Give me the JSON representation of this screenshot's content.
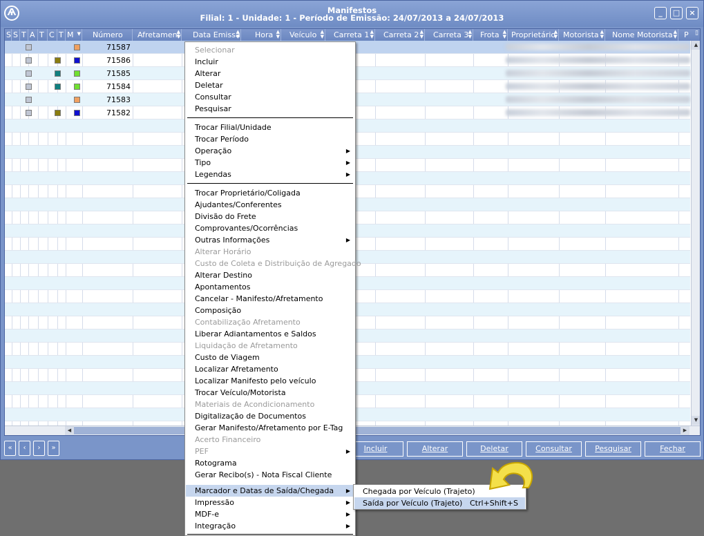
{
  "window": {
    "title": "Manifestos",
    "subtitle": "Filial: 1 - Unidade: 1 - Período de Emissão: 24/07/2013 a 24/07/2013",
    "logo_icon": "compass-logo-icon",
    "controls": {
      "minimize": "_",
      "maximize": "□",
      "close": "×"
    }
  },
  "grid": {
    "columns": [
      "S",
      "S",
      "T",
      "A",
      "T",
      "C",
      "T",
      "M",
      "Número",
      "Afretamento",
      "Data Emissão",
      "Hora",
      "Veículo",
      "Carreta 1",
      "Carreta 2",
      "Carreta 3",
      "Frota",
      "Proprietário",
      "Motorista",
      "Nome Motorista",
      "P"
    ],
    "rows": [
      {
        "numero": "71587",
        "c": "",
        "m": "#f0a060",
        "selected": true
      },
      {
        "numero": "71586",
        "c": "#8a7d10",
        "m": "#1010d0"
      },
      {
        "numero": "71585",
        "c": "#108080",
        "m": "#70e030"
      },
      {
        "numero": "71584",
        "c": "#108080",
        "m": "#70e030"
      },
      {
        "numero": "71583",
        "c": "",
        "m": "#f0a060"
      },
      {
        "numero": "71582",
        "c": "#8a7d10",
        "m": "#1010d0"
      }
    ]
  },
  "nav": {
    "first": "«",
    "prev": "‹",
    "next": "›",
    "last": "»"
  },
  "actions": {
    "incluir": "Incluir",
    "alterar": "Alterar",
    "deletar": "Deletar",
    "consultar": "Consultar",
    "pesquisar": "Pesquisar",
    "fechar": "Fechar"
  },
  "context_menu": {
    "items": [
      "Selecionar",
      "Incluir",
      "Alterar",
      "Deletar",
      "Consultar",
      "Pesquisar",
      "Trocar Filial/Unidade",
      "Trocar Período",
      "Operação",
      "Tipo",
      "Legendas",
      "Trocar Proprietário/Coligada",
      "Ajudantes/Conferentes",
      "Divisão do Frete",
      "Comprovantes/Ocorrências",
      "Outras Informações",
      "Alterar Horário",
      "Custo de Coleta e Distribuição de Agregado",
      "Alterar Destino",
      "Apontamentos",
      "Cancelar - Manifesto/Afretamento",
      "Composição",
      "Contabilização Afretamento",
      "Liberar Adiantamentos e Saldos",
      "Liquidação de Afretamento",
      "Custo de Viagem",
      "Localizar Afretamento",
      "Localizar Manifesto pelo veículo",
      "Trocar Veículo/Motorista",
      "Materiais de Acondicionamento",
      "Digitalização de Documentos",
      "Gerar Manifesto/Afretamento por E-Tag",
      "Acerto Financeiro",
      "PEF",
      "Rotograma",
      "Gerar Recibo(s) - Nota Fiscal Cliente",
      "Marcador e Datas de Saída/Chegada",
      "Impressão",
      "MDF-e",
      "Integração"
    ]
  },
  "submenu": {
    "chegada": "Chegada por Veículo (Trajeto)",
    "saida": "Saída por Veículo (Trajeto)",
    "saida_shortcut": "Ctrl+Shift+S"
  },
  "pointer_icon": "curved-arrow-pointer-icon"
}
